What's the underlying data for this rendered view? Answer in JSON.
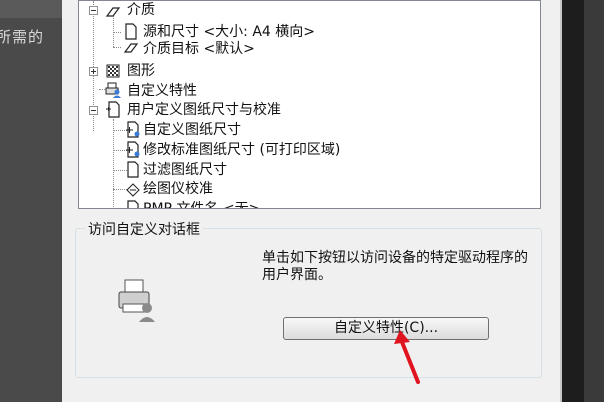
{
  "background": {
    "left_text": "所需的"
  },
  "tree": {
    "items": [
      {
        "label": "介质"
      },
      {
        "label": "源和尺寸 <大小: A4 横向>"
      },
      {
        "label": "介质目标 <默认>"
      },
      {
        "label": "图形"
      },
      {
        "label": "自定义特性"
      },
      {
        "label": "用户定义图纸尺寸与校准"
      },
      {
        "label": "自定义图纸尺寸"
      },
      {
        "label": "修改标准图纸尺寸 (可打印区域)"
      },
      {
        "label": "过滤图纸尺寸"
      },
      {
        "label": "绘图仪校准"
      },
      {
        "label": "PMP 文件名 <无>"
      }
    ]
  },
  "group": {
    "title": "访问自定义对话框",
    "description": "单击如下按钮以访问设备的特定驱动程序的用户界面。",
    "button_label": "自定义特性(C)..."
  },
  "colors": {
    "annotation_arrow": "#e0141e",
    "dialog_bg": "#f0f0f0"
  }
}
